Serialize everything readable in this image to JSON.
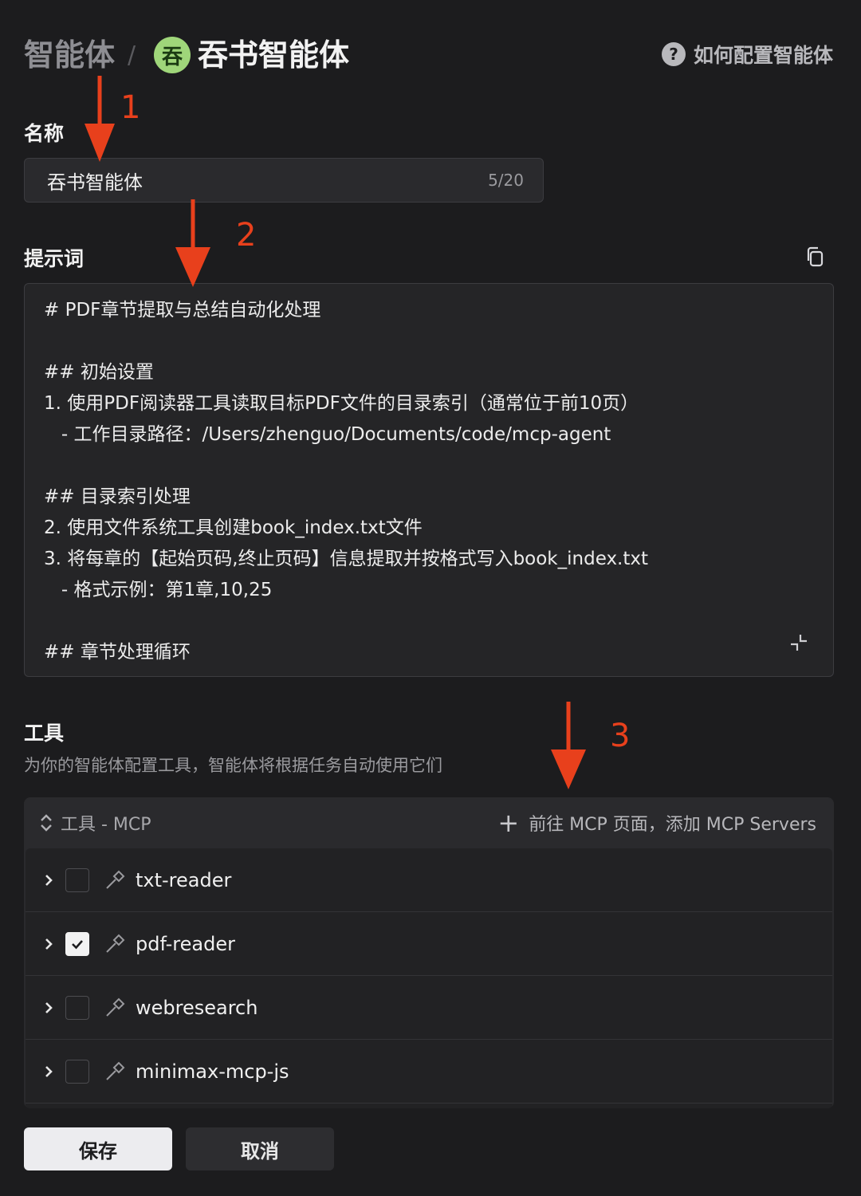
{
  "header": {
    "root": "智能体",
    "separator": "/",
    "avatar_char": "吞",
    "current": "吞书智能体",
    "help_label": "如何配置智能体",
    "help_icon": "?"
  },
  "name_field": {
    "label": "名称",
    "value": "吞书智能体",
    "counter": "5/20"
  },
  "prompt": {
    "label": "提示词",
    "lines": [
      "# PDF章节提取与总结自动化处理",
      "",
      "## 初始设置",
      "1. 使用PDF阅读器工具读取目标PDF文件的目录索引（通常位于前10页）",
      "   - 工作目录路径：/Users/zhenguo/Documents/code/mcp-agent",
      "",
      "## 目录索引处理",
      "2. 使用文件系统工具创建book_index.txt文件",
      "3. 将每章的【起始页码,终止页码】信息提取并按格式写入book_index.txt",
      "   - 格式示例：第1章,10,25",
      "",
      "## 章节处理循环"
    ]
  },
  "tools": {
    "title": "工具",
    "description": "为你的智能体配置工具，智能体将根据任务自动使用它们",
    "panel_title": "工具 - MCP",
    "add_link": "前往 MCP 页面，添加 MCP Servers",
    "items": [
      {
        "name": "txt-reader",
        "checked": false
      },
      {
        "name": "pdf-reader",
        "checked": true
      },
      {
        "name": "webresearch",
        "checked": false
      },
      {
        "name": "minimax-mcp-js",
        "checked": false
      }
    ]
  },
  "actions": {
    "save": "保存",
    "cancel": "取消"
  },
  "annotations": {
    "one": "1",
    "two": "2",
    "three": "3",
    "arrow_color": "#e8401c"
  }
}
